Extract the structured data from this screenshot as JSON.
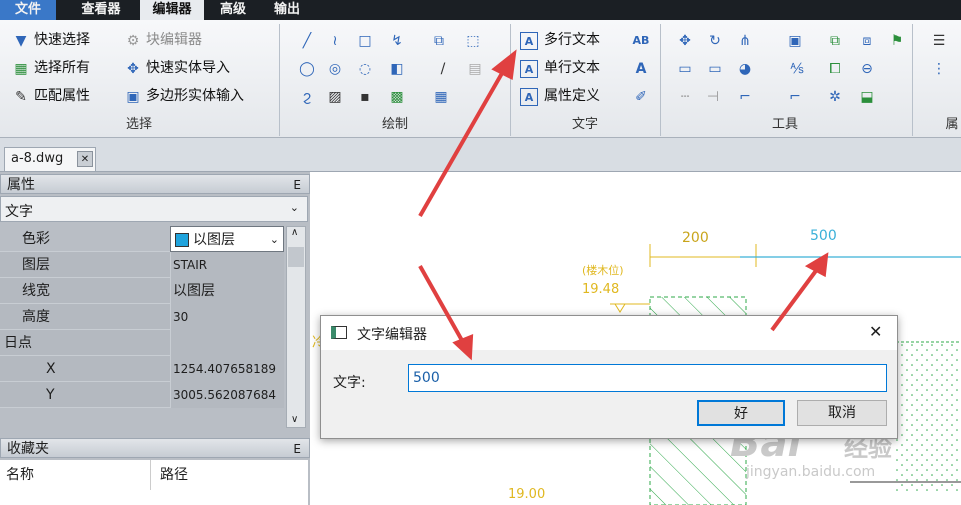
{
  "menu": {
    "file": "文件",
    "viewer": "查看器",
    "editor": "编辑器",
    "advanced": "高级",
    "output": "输出"
  },
  "ribbon": {
    "select_group": {
      "label": "选择",
      "quick_select": "快速选择",
      "block_edit": "块编辑器",
      "select_all": "选择所有",
      "quick_import": "快速实体导入",
      "match_props": "匹配属性",
      "polygon_input": "多边形实体输入"
    },
    "draw_group": {
      "label": "绘制"
    },
    "text_group": {
      "label": "文字",
      "mtext": "多行文本",
      "stext": "单行文本",
      "attdef": "属性定义"
    },
    "tools_group": {
      "label": "工具"
    },
    "more_label": "属"
  },
  "doc_tab": {
    "name": "a-8.dwg",
    "close": "✕"
  },
  "properties": {
    "title": "属性",
    "pin": "ᵖ",
    "type_select": "文字",
    "rows": [
      {
        "key": "色彩",
        "value": "以图层"
      },
      {
        "key": "图层",
        "value": "STAIR"
      },
      {
        "key": "线宽",
        "value": "以图层"
      },
      {
        "key": "高度",
        "value": "30"
      },
      {
        "key": "日点",
        "value": ""
      },
      {
        "key": "X",
        "value": "1254.407658189"
      },
      {
        "key": "Y",
        "value": "3005.562087684"
      }
    ],
    "color_swatch": "#1fa3dc"
  },
  "favorites": {
    "title": "收藏夹",
    "col_name": "名称",
    "col_path": "路径"
  },
  "drawing": {
    "dim_200": "200",
    "dim_500": "500",
    "level_note": "(楼木位)",
    "level_1948": "19.48",
    "level_1900": "19.00",
    "left_text": "冷"
  },
  "dialog": {
    "title": "文字编辑器",
    "close": "✕",
    "label": "文字:",
    "value": "500",
    "ok": "好",
    "cancel": "取消"
  },
  "watermark": {
    "brand": "Bai",
    "brand2": "经验",
    "url": "jingyan.baidu.com"
  },
  "colors": {
    "accent": "#3a78c8",
    "arrow": "#e04040",
    "cyan_line": "#3ab0d8",
    "yellow_dim": "#e0b820",
    "green_fill": "#2fa84a"
  }
}
